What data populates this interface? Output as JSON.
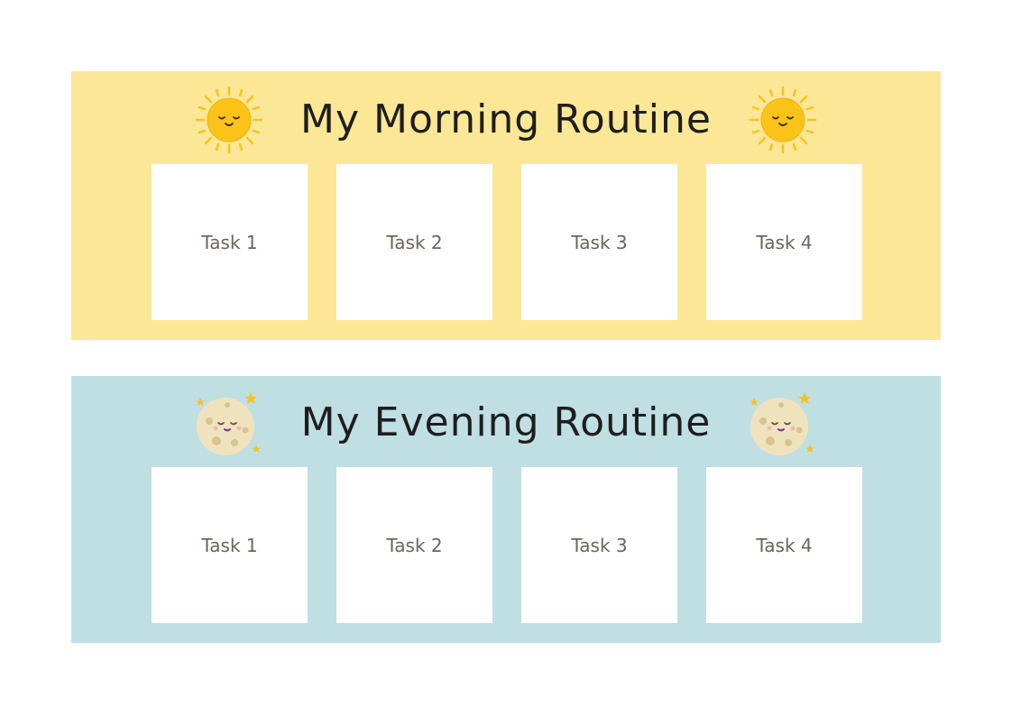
{
  "morning": {
    "title": "My Morning Routine",
    "icon": "sun-icon",
    "color": "#fce796",
    "tasks": [
      "Task 1",
      "Task 2",
      "Task 3",
      "Task 4"
    ]
  },
  "evening": {
    "title": "My Evening Routine",
    "icon": "moon-icon",
    "color": "#bfdfe3",
    "tasks": [
      "Task 1",
      "Task 2",
      "Task 3",
      "Task 4"
    ]
  }
}
